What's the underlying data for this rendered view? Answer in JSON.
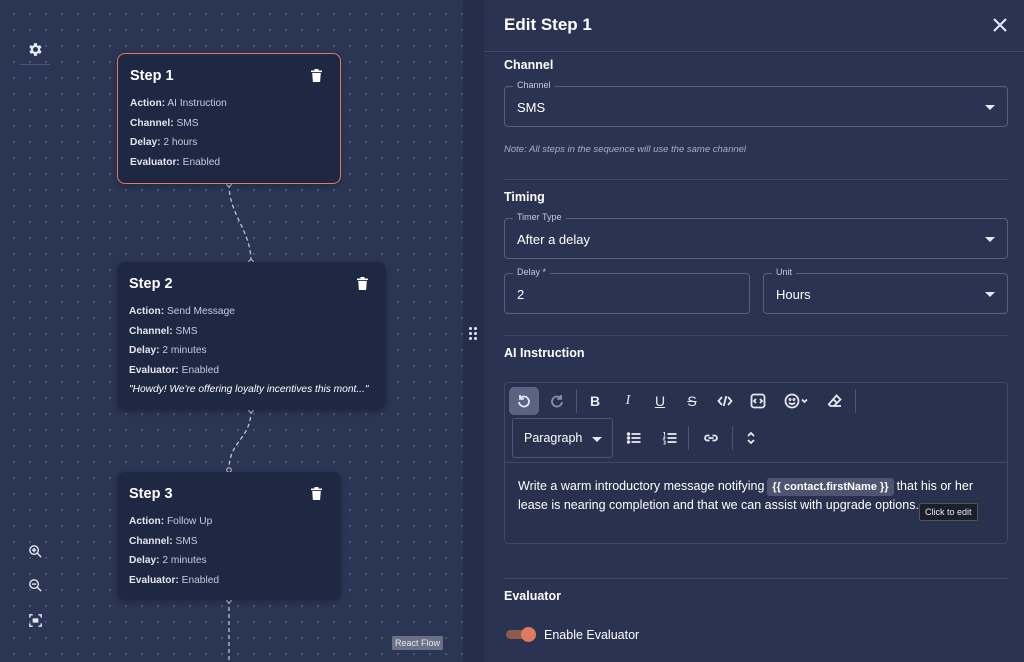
{
  "canvas": {
    "badge": "React Flow",
    "nodes": [
      {
        "title": "Step 1",
        "action_label": "Action:",
        "action": "AI Instruction",
        "channel_label": "Channel:",
        "channel": "SMS",
        "delay_label": "Delay:",
        "delay": "2 hours",
        "evaluator_label": "Evaluator:",
        "evaluator": "Enabled",
        "selected": true
      },
      {
        "title": "Step 2",
        "action_label": "Action:",
        "action": "Send Message",
        "channel_label": "Channel:",
        "channel": "SMS",
        "delay_label": "Delay:",
        "delay": "2 minutes",
        "evaluator_label": "Evaluator:",
        "evaluator": "Enabled",
        "message": "\"Howdy! We're offering loyalty incentives this mont...\""
      },
      {
        "title": "Step 3",
        "action_label": "Action:",
        "action": "Follow Up",
        "channel_label": "Channel:",
        "channel": "SMS",
        "delay_label": "Delay:",
        "delay": "2 minutes",
        "evaluator_label": "Evaluator:",
        "evaluator": "Enabled"
      }
    ]
  },
  "panel": {
    "title": "Edit Step 1",
    "channel_section": {
      "title": "Channel",
      "field_label": "Channel",
      "value": "SMS",
      "note": "Note: All steps in the sequence will use the same channel"
    },
    "timing_section": {
      "title": "Timing",
      "timer_type_label": "Timer Type",
      "timer_type_value": "After a delay",
      "delay_label": "Delay *",
      "delay_value": "2",
      "unit_label": "Unit",
      "unit_value": "Hours"
    },
    "ai_section": {
      "title": "AI Instruction",
      "paragraph_label": "Paragraph",
      "text_before": "Write a warm introductory message notifying",
      "variable": "{{ contact.firstName }}",
      "text_after": "that his or her lease is nearing completion and that we can assist with upgrade options.",
      "tooltip": "Click to edit"
    },
    "evaluator_section": {
      "title": "Evaluator",
      "toggle_label": "Enable Evaluator",
      "enabled": true
    }
  },
  "colors": {
    "accent": "#e07a5f",
    "background": "#2a3452",
    "node": "#1f2843"
  }
}
